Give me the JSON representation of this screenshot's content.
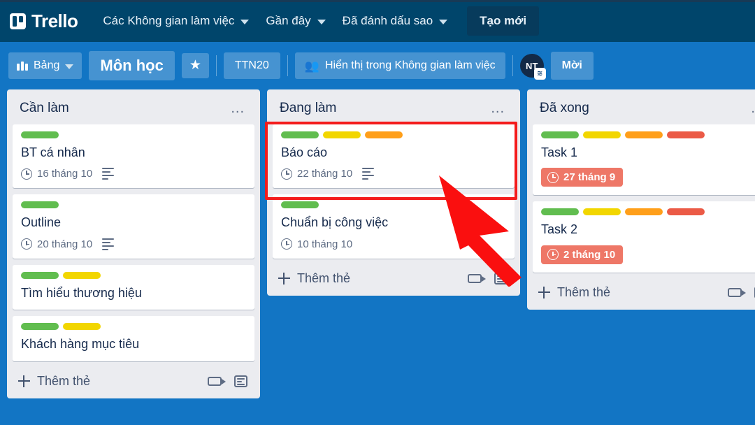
{
  "topnav": {
    "brand": "Trello",
    "items": [
      {
        "label": "Các Không gian làm việc",
        "caret": true
      },
      {
        "label": "Gần đây",
        "caret": true
      },
      {
        "label": "Đã đánh dấu sao",
        "caret": true
      }
    ],
    "create_label": "Tạo mới"
  },
  "boardbar": {
    "view_label": "Bảng",
    "board_title": "Môn học",
    "star_icon": "★",
    "workspace_code": "TTN20",
    "visibility_label": "Hiển thị trong Không gian làm việc",
    "avatar_initials": "NT",
    "avatar_badge": "≋",
    "invite_label": "Mời"
  },
  "colors": {
    "top_bar": "#00456b",
    "board_background": "#1275c4",
    "list_background": "#ebecf0",
    "label_green": "#61bd4f",
    "label_yellow": "#f2d600",
    "label_orange": "#ff9f1a",
    "label_red": "#eb5a46",
    "overdue_badge": "#eb5a46",
    "highlight_box": "#f41c1c",
    "cursor_arrow": "#fa0f0f"
  },
  "lists": [
    {
      "title": "Cần làm",
      "menu_icon": "...",
      "add_card_label": "Thêm thẻ",
      "cards": [
        {
          "title": "BT cá nhân",
          "labels": [
            "label_green"
          ],
          "due": "16 tháng 10",
          "due_overdue": false,
          "has_description": true
        },
        {
          "title": "Outline",
          "labels": [
            "label_green"
          ],
          "due": "20 tháng 10",
          "due_overdue": false,
          "has_description": true
        },
        {
          "title": "Tìm hiểu thương hiệu",
          "labels": [
            "label_green",
            "label_yellow"
          ],
          "due": null,
          "due_overdue": false,
          "has_description": false
        },
        {
          "title": "Khách hàng mục tiêu",
          "labels": [
            "label_green",
            "label_yellow"
          ],
          "due": null,
          "due_overdue": false,
          "has_description": false
        }
      ]
    },
    {
      "title": "Đang làm",
      "menu_icon": "...",
      "add_card_label": "Thêm thẻ",
      "cards": [
        {
          "title": "Báo cáo",
          "labels": [
            "label_green",
            "label_yellow",
            "label_orange"
          ],
          "due": "22 tháng 10",
          "due_overdue": false,
          "has_description": true,
          "highlighted": true
        },
        {
          "title": "Chuẩn bị công việc",
          "labels": [
            "label_green"
          ],
          "due": "10 tháng 10",
          "due_overdue": false,
          "has_description": false
        }
      ]
    },
    {
      "title": "Đã xong",
      "menu_icon": "...",
      "add_card_label": "Thêm thẻ",
      "cards": [
        {
          "title": "Task 1",
          "labels": [
            "label_green",
            "label_yellow",
            "label_orange",
            "label_red"
          ],
          "due": "27 tháng 9",
          "due_overdue": true,
          "has_description": false
        },
        {
          "title": "Task 2",
          "labels": [
            "label_green",
            "label_yellow",
            "label_orange",
            "label_red"
          ],
          "due": "2 tháng 10",
          "due_overdue": true,
          "has_description": false
        }
      ]
    }
  ]
}
